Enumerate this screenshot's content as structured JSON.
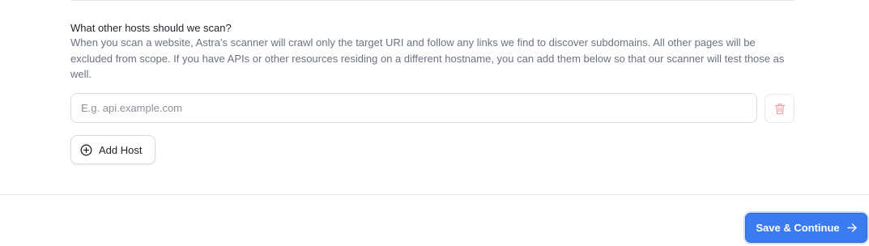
{
  "hosts_section": {
    "title": "What other hosts should we scan?",
    "description": "When you scan a website, Astra's scanner will crawl only the target URI and follow any links we find to discover subdomains. All other pages will be excluded from scope. If you have APIs or other resources residing on a different hostname, you can add them below so that our scanner will test those as well.",
    "host_input": {
      "value": "",
      "placeholder": "E.g. api.example.com"
    },
    "delete_icon": "trash-icon",
    "add_host_label": "Add Host",
    "add_host_icon": "plus-circle-icon"
  },
  "footer": {
    "save_label": "Save & Continue",
    "save_icon": "arrow-right-icon"
  },
  "colors": {
    "primary": "#3b7bf0",
    "danger_icon": "#f2a3a3",
    "muted_text": "#6b7280",
    "border": "#d9dce1"
  }
}
